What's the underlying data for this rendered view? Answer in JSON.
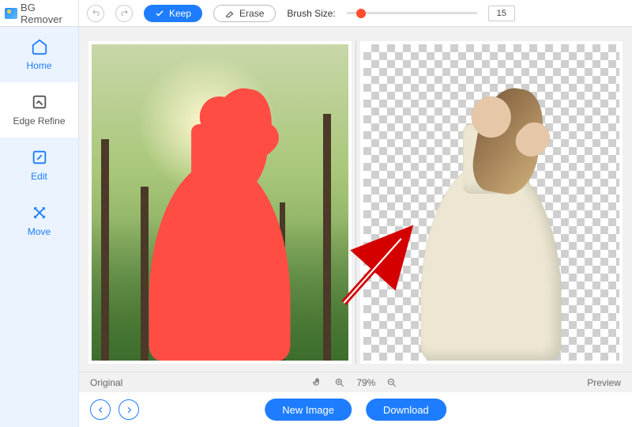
{
  "app": {
    "title": "BG Remover"
  },
  "sidebar": {
    "items": [
      {
        "label": "Home"
      },
      {
        "label": "Edge Refine"
      },
      {
        "label": "Edit"
      },
      {
        "label": "Move"
      }
    ]
  },
  "toolbar": {
    "keep_label": "Keep",
    "erase_label": "Erase",
    "brush_label": "Brush Size:",
    "brush_value": "15"
  },
  "status": {
    "left_label": "Original",
    "zoom": "79%",
    "right_label": "Preview"
  },
  "actions": {
    "new_image": "New Image",
    "download": "Download"
  },
  "icons": {
    "undo": "undo-icon",
    "redo": "redo-icon",
    "keep": "check-icon",
    "erase": "eraser-icon",
    "home": "home-icon",
    "edge": "edge-refine-icon",
    "edit": "edit-icon",
    "move": "move-icon",
    "pan": "hand-icon",
    "zoom_in": "zoom-in-icon",
    "zoom_out": "zoom-out-icon",
    "prev": "chevron-left-icon",
    "next": "chevron-right-icon"
  },
  "colors": {
    "accent": "#1e7dff",
    "brush": "#ff4d2d"
  }
}
